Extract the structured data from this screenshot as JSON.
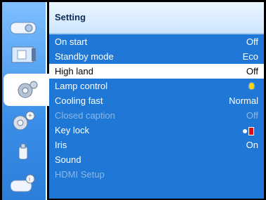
{
  "panel": {
    "title": "Setting"
  },
  "menu": [
    {
      "label": "On start",
      "value": "Off",
      "state": "normal",
      "icon": ""
    },
    {
      "label": "Standby mode",
      "value": "Eco",
      "state": "normal",
      "icon": ""
    },
    {
      "label": "High land",
      "value": "Off",
      "state": "selected",
      "icon": ""
    },
    {
      "label": "Lamp control",
      "value": "",
      "state": "normal",
      "icon": "lamp-bulb-icon"
    },
    {
      "label": "Cooling fast",
      "value": "Normal",
      "state": "normal",
      "icon": ""
    },
    {
      "label": "Closed caption",
      "value": "Off",
      "state": "disabled",
      "icon": ""
    },
    {
      "label": "Key lock",
      "value": "",
      "state": "normal",
      "icon": "key-lock-icon"
    },
    {
      "label": "Iris",
      "value": "On",
      "state": "normal",
      "icon": ""
    },
    {
      "label": "Sound",
      "value": "",
      "state": "normal",
      "icon": ""
    },
    {
      "label": "HDMI Setup",
      "value": "",
      "state": "disabled",
      "icon": ""
    }
  ],
  "sidebar": {
    "tabs": [
      {
        "icon": "projector-icon"
      },
      {
        "icon": "input-icon"
      },
      {
        "icon": "settings-gears-icon"
      },
      {
        "icon": "advanced-gears-icon"
      },
      {
        "icon": "usb-icon"
      },
      {
        "icon": "info-icon"
      }
    ]
  },
  "colors": {
    "accent": "#1f78d6",
    "selected_bg": "#ffffff",
    "disabled_text": "#8bb7e6",
    "bulb": "#ffd400"
  }
}
